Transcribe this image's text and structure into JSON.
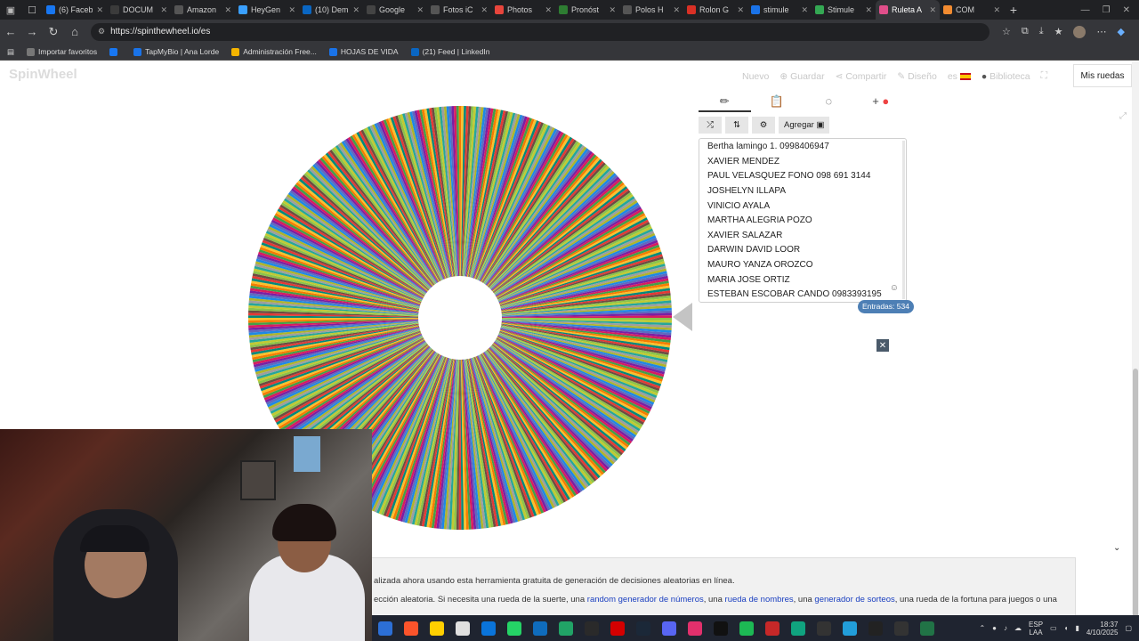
{
  "browser": {
    "tabs": [
      {
        "label": "(6) Faceb",
        "color": "#1877f2"
      },
      {
        "label": "DOCUM",
        "color": "#3b3b3b"
      },
      {
        "label": "Amazon",
        "color": "#555"
      },
      {
        "label": "HeyGen",
        "color": "#3aa0ff"
      },
      {
        "label": "(10) Dem",
        "color": "#0a66c2"
      },
      {
        "label": "Google",
        "color": "#444"
      },
      {
        "label": "Fotos iC",
        "color": "#555"
      },
      {
        "label": "Photos",
        "color": "#e8453c"
      },
      {
        "label": "Pronóst",
        "color": "#2e7d32"
      },
      {
        "label": "Polos H",
        "color": "#555"
      },
      {
        "label": "Rolon G",
        "color": "#d93025"
      },
      {
        "label": "stimule",
        "color": "#1a73e8"
      },
      {
        "label": "Stimule",
        "color": "#34a853"
      },
      {
        "label": "Ruleta A",
        "color": "#e04e8a"
      },
      {
        "label": "COM",
        "color": "#f28b30"
      }
    ],
    "url": "https://spinthewheel.io/es",
    "bookmarks": [
      {
        "label": "Importar favoritos",
        "color": "#777"
      },
      {
        "label": "",
        "color": "#1877f2"
      },
      {
        "label": "TapMyBio | Ana Lorde",
        "color": "#1a73e8"
      },
      {
        "label": "Administración Free...",
        "color": "#f4b400"
      },
      {
        "label": "HOJAS DE VIDA",
        "color": "#1a73e8"
      },
      {
        "label": "(21) Feed | LinkedIn",
        "color": "#0a66c2"
      }
    ]
  },
  "page": {
    "logo": "SpinWheel",
    "nav": {
      "nuevo": "Nuevo",
      "guardar": "Guardar",
      "compartir": "Compartir",
      "diseno": "Diseño",
      "lang": "es",
      "biblioteca": "Biblioteca",
      "mis_ruedas": "Mis ruedas"
    },
    "editor": {
      "add_label": "Agregar",
      "entries": [
        "Bertha lamingo 1. 0998406947",
        "XAVIER MENDEZ",
        "PAUL VELASQUEZ FONO 098 691 3144",
        "JOSHELYN ILLAPA",
        "VINICIO AYALA",
        "MARTHA ALEGRIA POZO",
        "XAVIER SALAZAR",
        "DARWIN DAVID LOOR",
        "MAURO YANZA OROZCO",
        "MARIA JOSE ORTIZ",
        "ESTEBAN ESCOBAR CANDO 0983393195"
      ],
      "entries_count": "Entradas: 534"
    },
    "wheel": {
      "segment_count": 534,
      "palette": [
        "#8bc34a",
        "#e53935",
        "#fbc02d",
        "#43a047",
        "#7b1fa2",
        "#1e88e5",
        "#9e9e9e",
        "#c0ca33",
        "#6d4c41",
        "#00897b",
        "#f57c00",
        "#d81b60",
        "#5c6bc0",
        "#afb42b",
        "#26a69a"
      ]
    },
    "description": {
      "line1": "alizada ahora usando esta herramienta gratuita de generación de decisiones aleatorias en línea.",
      "line2_pre": "ección aleatoria. Si necesita una rueda de la suerte, una ",
      "link1": "random generador de números",
      "sep1": ", una ",
      "link2": "rueda de nombres",
      "sep2": ", una ",
      "link3": "generador de sorteos",
      "line2_post": ", una rueda de la fortuna para juegos o una"
    }
  },
  "taskbar": {
    "icons": [
      "#2c6fd6",
      "#fb542b",
      "#ffcf00",
      "#e0e0e0",
      "#0a74da",
      "#25d366",
      "#0f6cbd",
      "#21a366",
      "#2a2a2a",
      "#d40000",
      "#1b2838",
      "#5865f2",
      "#e1306c",
      "#111",
      "#1db954",
      "#c62828",
      "#10a37f",
      "#333",
      "#229ed9",
      "#222",
      "#333",
      "#217346"
    ],
    "lang_top": "ESP",
    "lang_bottom": "LAA",
    "time": "18:37",
    "date": "4/10/2025"
  }
}
